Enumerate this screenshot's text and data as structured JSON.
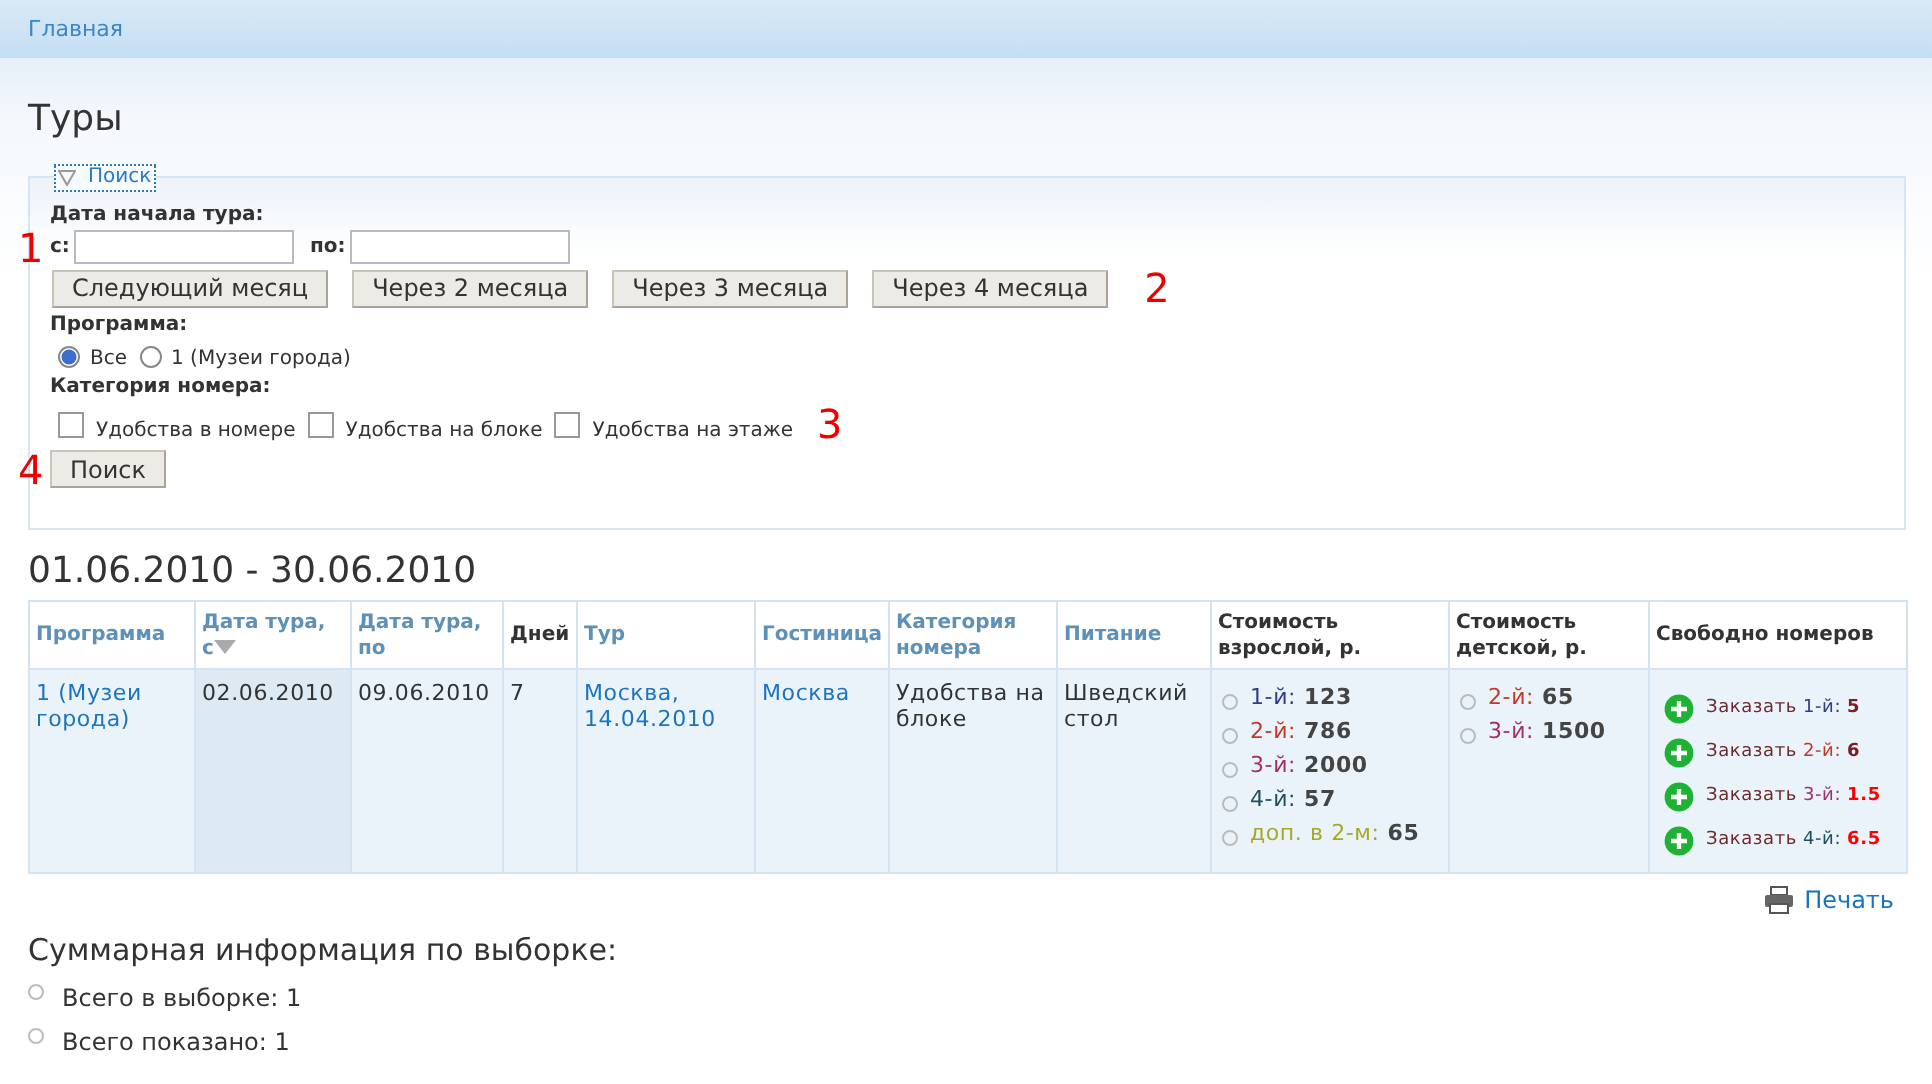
{
  "breadcrumb": {
    "label": "Главная"
  },
  "title": "Туры",
  "search": {
    "legend": "Поиск",
    "date_label": "Дата начала тура:",
    "from_label": "с:",
    "to_label": "по:",
    "month_buttons": [
      "Следующий месяц",
      "Через 2 месяца",
      "Через 3 месяца",
      "Через 4 месяца"
    ],
    "program_label": "Программа:",
    "program_options": [
      {
        "label": "Все",
        "selected": true
      },
      {
        "label": "1 (Музеи города)",
        "selected": false
      }
    ],
    "category_label": "Категория номера:",
    "category_options": [
      {
        "label": "Удобства в номере",
        "checked": false
      },
      {
        "label": "Удобства на блоке",
        "checked": false
      },
      {
        "label": "Удобства на этаже",
        "checked": false
      }
    ],
    "submit": "Поиск",
    "annotations": [
      "1",
      "2",
      "3",
      "4"
    ]
  },
  "period": "01.06.2010 - 30.06.2010",
  "table": {
    "columns": [
      {
        "label": "Программа",
        "sortable": true,
        "sorted": false
      },
      {
        "label": "Дата тура, с",
        "sortable": true,
        "sorted": true
      },
      {
        "label": "Дата тура, по",
        "sortable": true,
        "sorted": false
      },
      {
        "label": "Дней",
        "sortable": false,
        "sorted": false
      },
      {
        "label": "Тур",
        "sortable": true,
        "sorted": false
      },
      {
        "label": "Гостиница",
        "sortable": true,
        "sorted": false
      },
      {
        "label": "Категория номера",
        "sortable": true,
        "sorted": false
      },
      {
        "label": "Питание",
        "sortable": true,
        "sorted": false
      },
      {
        "label": "Стоимость взрослой, р.",
        "sortable": false,
        "sorted": false
      },
      {
        "label": "Стоимость детской, р.",
        "sortable": false,
        "sorted": false
      },
      {
        "label": "Свободно номеров",
        "sortable": false,
        "sorted": false
      }
    ],
    "rows": [
      {
        "cells": [
          {
            "kind": "link",
            "text": "1 (Музеи города)"
          },
          {
            "kind": "text",
            "text": "02.06.2010"
          },
          {
            "kind": "text",
            "text": "09.06.2010"
          },
          {
            "kind": "text",
            "text": "7"
          },
          {
            "kind": "link",
            "text": "Москва, 14.04.2010"
          },
          {
            "kind": "link",
            "text": "Москва"
          },
          {
            "kind": "text",
            "text": "Удобства на блоке"
          },
          {
            "kind": "text",
            "text": "Шведский стол"
          },
          {
            "kind": "prices",
            "items": [
              {
                "label": "1-й:",
                "color": "#2e3c8a",
                "value": "123"
              },
              {
                "label": "2-й:",
                "color": "#c0392b",
                "value": "786"
              },
              {
                "label": "3-й:",
                "color": "#a0306a",
                "value": "2000"
              },
              {
                "label": "4-й:",
                "color": "#1f4e5e",
                "value": "57"
              },
              {
                "label": "доп. в 2-м:",
                "color": "#a8a828",
                "value": "65"
              }
            ]
          },
          {
            "kind": "prices",
            "items": [
              {
                "label": "2-й:",
                "color": "#c0392b",
                "value": "65"
              },
              {
                "label": "3-й:",
                "color": "#a0306a",
                "value": "1500"
              }
            ]
          },
          {
            "kind": "orders",
            "items": [
              {
                "action": "Заказать",
                "label": "1-й:",
                "color": "#2e3c8a",
                "count": "5",
                "highlighted": false
              },
              {
                "action": "Заказать",
                "label": "2-й:",
                "color": "#c0392b",
                "count": "6",
                "highlighted": false
              },
              {
                "action": "Заказать",
                "label": "3-й:",
                "color": "#a0306a",
                "count": "1.5",
                "highlighted": true
              },
              {
                "action": "Заказать",
                "label": "4-й:",
                "color": "#1f4e5e",
                "count": "6.5",
                "highlighted": true
              }
            ]
          }
        ]
      }
    ]
  },
  "print": "Печать",
  "summary": {
    "title": "Суммарная информация по выборке:",
    "items": [
      "Всего в выборке: 1",
      "Всего показано: 1"
    ]
  }
}
